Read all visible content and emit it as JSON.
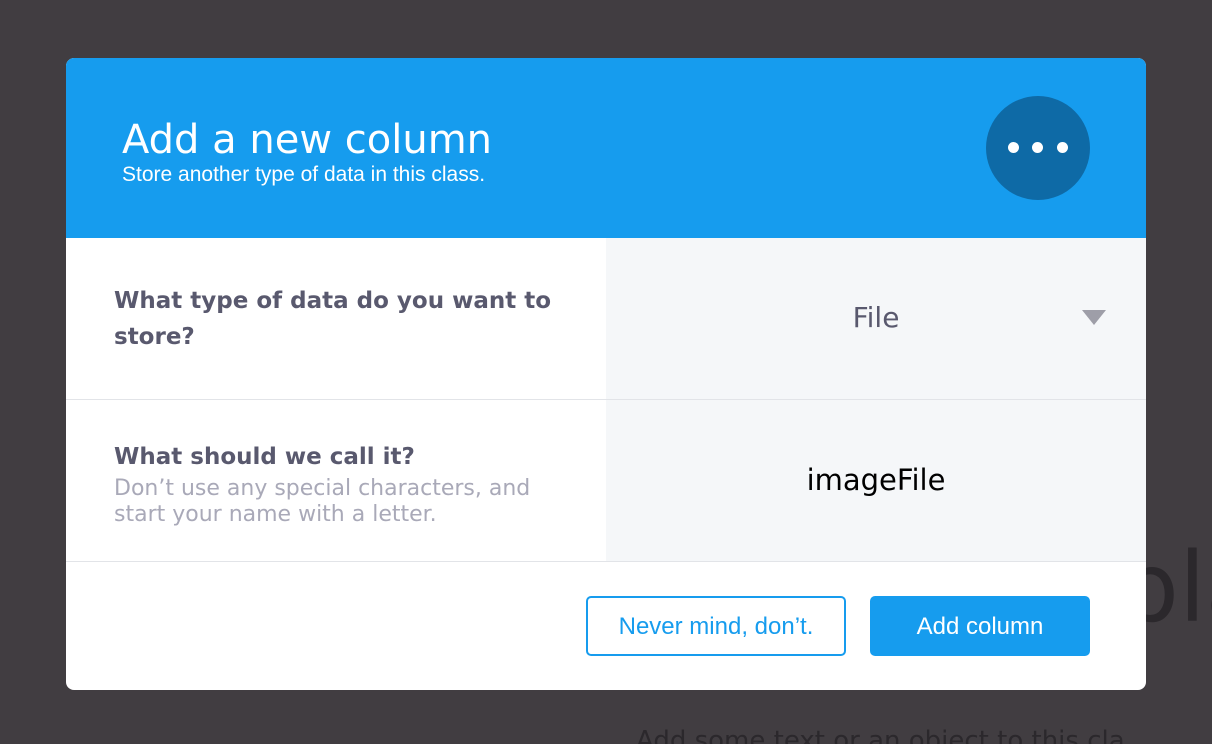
{
  "background": {
    "large_text": "pla",
    "small_text": "Add some text or an object to this cla"
  },
  "modal": {
    "title": "Add a new column",
    "subtitle": "Store another type of data in this class.",
    "header_icon": "more-dots-icon",
    "colors": {
      "header": "#169cee",
      "icon_circle": "#0e6aa6",
      "label": "#59596e",
      "hint": "#a9a9b8"
    },
    "type_field": {
      "label": "What type of data do you want to store?",
      "selected": "File"
    },
    "name_field": {
      "label": "What should we call it?",
      "hint": "Don’t use any special characters, and start your name with a letter.",
      "value": "imageFile"
    },
    "buttons": {
      "cancel": "Never mind, don’t.",
      "submit": "Add column"
    }
  }
}
